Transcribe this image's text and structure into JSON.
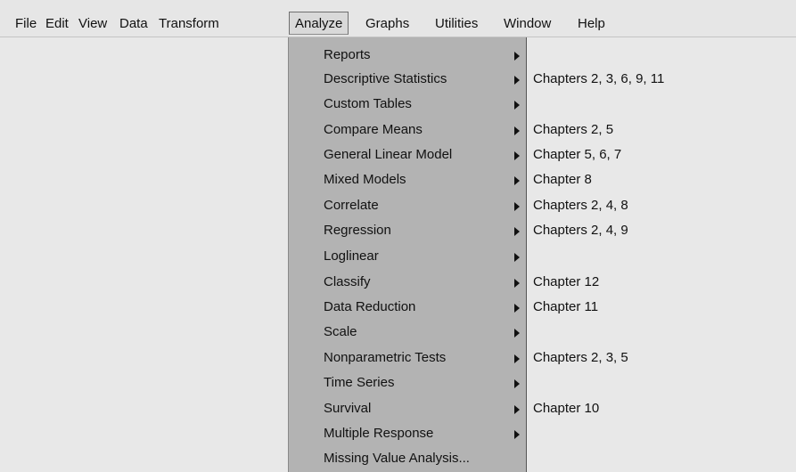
{
  "menubar": {
    "items": [
      {
        "label": "File"
      },
      {
        "label": "Edit"
      },
      {
        "label": "View"
      },
      {
        "label": "Data"
      },
      {
        "label": "Transform"
      },
      {
        "label": "Analyze"
      },
      {
        "label": "Graphs"
      },
      {
        "label": "Utilities"
      },
      {
        "label": "Window"
      },
      {
        "label": "Help"
      }
    ],
    "active": "Analyze"
  },
  "analyze_menu": {
    "items": [
      {
        "label": "Reports",
        "submenu": true
      },
      {
        "label": "Descriptive Statistics",
        "submenu": true
      },
      {
        "label": "Custom Tables",
        "submenu": true
      },
      {
        "label": "Compare Means",
        "submenu": true
      },
      {
        "label": "General Linear Model",
        "submenu": true
      },
      {
        "label": "Mixed Models",
        "submenu": true
      },
      {
        "label": "Correlate",
        "submenu": true
      },
      {
        "label": "Regression",
        "submenu": true
      },
      {
        "label": "Loglinear",
        "submenu": true
      },
      {
        "label": "Classify",
        "submenu": true
      },
      {
        "label": "Data Reduction",
        "submenu": true
      },
      {
        "label": "Scale",
        "submenu": true
      },
      {
        "label": "Nonparametric Tests",
        "submenu": true
      },
      {
        "label": "Time Series",
        "submenu": true
      },
      {
        "label": "Survival",
        "submenu": true
      },
      {
        "label": "Multiple Response",
        "submenu": true
      },
      {
        "label": "Missing Value Analysis...",
        "submenu": false
      }
    ]
  },
  "annotations": [
    {
      "item": "Descriptive Statistics",
      "text": "Chapters 2, 3, 6, 9, 11"
    },
    {
      "item": "Compare Means",
      "text": "Chapters 2, 5"
    },
    {
      "item": "General Linear Model",
      "text": "Chapter 5, 6, 7"
    },
    {
      "item": "Mixed Models",
      "text": "Chapter 8"
    },
    {
      "item": "Correlate",
      "text": "Chapters 2, 4, 8"
    },
    {
      "item": "Regression",
      "text": "Chapters 2, 4, 9"
    },
    {
      "item": "Classify",
      "text": "Chapter 12"
    },
    {
      "item": "Data Reduction",
      "text": "Chapter 11"
    },
    {
      "item": "Nonparametric Tests",
      "text": "Chapters 2, 3, 5"
    },
    {
      "item": "Survival",
      "text": "Chapter 10"
    }
  ]
}
